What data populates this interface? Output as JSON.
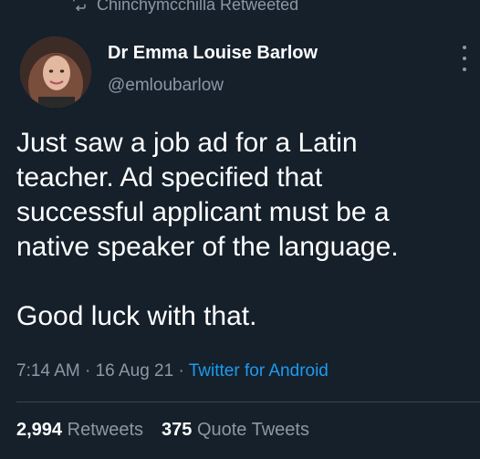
{
  "retweet": {
    "label": "Chinchymcchilla Retweeted",
    "icon": "retweet-icon"
  },
  "author": {
    "name": "Dr Emma Louise Barlow",
    "handle": "@emloubarlow"
  },
  "tweet": {
    "paragraph1": [
      "Just saw a job ad for a Latin",
      "teacher. Ad specified that",
      "successful applicant must be a",
      "native speaker of the language."
    ],
    "paragraph2": "Good luck with that."
  },
  "meta": {
    "time": "7:14 AM",
    "date": "16 Aug 21",
    "source": "Twitter for Android"
  },
  "stats": {
    "retweets_count": "2,994",
    "retweets_label": "Retweets",
    "quotes_count": "375",
    "quotes_label": "Quote Tweets"
  },
  "colors": {
    "background": "#15202b",
    "muted": "#8b98a5",
    "link": "#1d9bf0",
    "text": "#ffffff"
  }
}
